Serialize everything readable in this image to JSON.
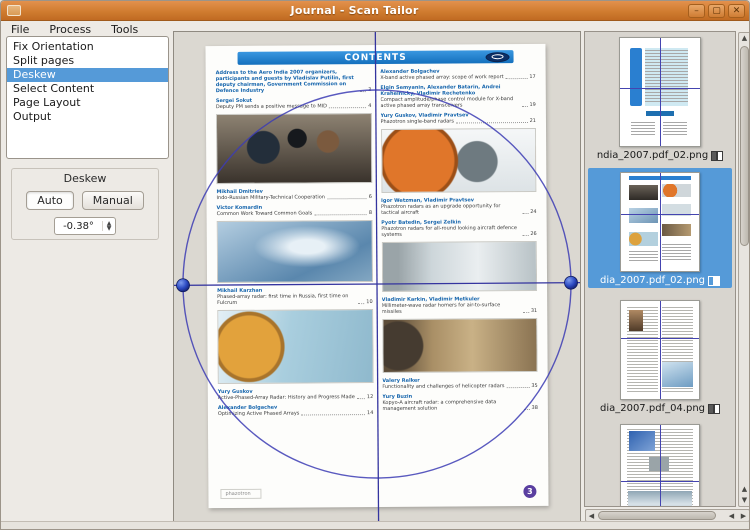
{
  "window": {
    "title": "Journal - Scan Tailor",
    "menu": [
      "File",
      "Process",
      "Tools"
    ]
  },
  "icons": {
    "minimize": "–",
    "maximize": "▢",
    "close": "✕",
    "spin_up": "▲",
    "spin_down": "▼",
    "scroll_up": "▲",
    "scroll_down": "▼",
    "scroll_left": "◀",
    "scroll_right": "▶"
  },
  "stages": {
    "items": [
      "Fix Orientation",
      "Split pages",
      "Deskew",
      "Select Content",
      "Page Layout",
      "Output"
    ],
    "selected": "Deskew"
  },
  "deskew_panel": {
    "title": "Deskew",
    "auto_label": "Auto",
    "manual_label": "Manual",
    "angle_value": "-0.38°"
  },
  "page": {
    "header": "CONTENTS",
    "footer_text": "phazotron",
    "page_number": "3",
    "left_column": [
      {
        "lead": true,
        "title": "Address to the Aero India 2007 organizers, participants and guests by Vladislav Putilin, first deputy chairman, Government Commission on Defence Industry",
        "page": "3"
      },
      {
        "author": "Sergei Sokut",
        "title": "Deputy PM sends a positive message to MID",
        "page": "4"
      },
      {
        "photo": "group",
        "alt": "officials-group-photo"
      },
      {
        "author": "Mikhail Dmitriev",
        "title": "Indo-Russian Military-Technical Cooperation",
        "page": "6"
      },
      {
        "author": "Victor Komardin",
        "title": "Common Work Toward Common Goals",
        "page": "8"
      },
      {
        "photo": "jet",
        "alt": "fighter-aircraft-photo"
      },
      {
        "author": "Mikhail Karzhan",
        "title": "Phased-array radar: first time in Russia, first time on Fulcrum",
        "page": "10"
      },
      {
        "photo": "radar-cyan",
        "alt": "radar-unit-photo"
      },
      {
        "author": "Yury Guskov",
        "title": "Active-Phased-Array Radar: History and Progress Made",
        "page": "12"
      },
      {
        "author": "Alexander Bolgachev",
        "title": "Optimizing Active Phased Arrays",
        "page": "14"
      }
    ],
    "right_column": [
      {
        "author": "Alexander Bolgachev",
        "title": "X-band active phased array: scope of work report",
        "page": "17"
      },
      {
        "author": "Elgin Semyanin, Alexander Batarin, Andrei Krahelnicky, Vladimir Rechetenko",
        "title": "Compact amplitude/phase control module for X-band active phased array transceivers",
        "page": "19"
      },
      {
        "author": "Yury Guskov, Vladimir Pravtsev",
        "title": "Phazotron single-band radars",
        "page": "21"
      },
      {
        "photo": "radar-orange",
        "alt": "phased-array-radar-photo"
      },
      {
        "author": "Igor Wetzman, Vladimir Pravtsev",
        "title": "Phazotron radars as an upgrade opportunity for tactical aircraft",
        "page": "24"
      },
      {
        "author": "Pyotr Batedin, Sergei Zelkin",
        "title": "Phazotron radars for all-round looking aircraft defence systems",
        "page": "26"
      },
      {
        "photo": "equipment",
        "alt": "radar-equipment-photo"
      },
      {
        "author": "Vladimir Karkin, Vladimir Metkuler",
        "title": "Millimeter-wave radar homers for air-to-surface missiles",
        "page": "31"
      },
      {
        "photo": "seeker",
        "alt": "radar-seeker-photo"
      },
      {
        "author": "Valery Relker",
        "title": "Functionality and challenges of helicopter radars",
        "page": "35"
      },
      {
        "author": "Yury Buzin",
        "title": "Kopyo-A aircraft radar: a comprehensive data management solution",
        "page": "38"
      }
    ]
  },
  "thumbnails": [
    {
      "caption": "ndia_2007.pdf_02.png",
      "side": "left",
      "selected": false
    },
    {
      "caption": "dia_2007.pdf_02.png",
      "side": "right",
      "selected": true
    },
    {
      "caption": "dia_2007.pdf_04.png",
      "side": "left",
      "selected": false
    },
    {
      "caption": "",
      "side": "",
      "selected": false
    }
  ],
  "colors": {
    "titlebar_orange": "#d07c30",
    "selection_blue": "#559ad8",
    "overlay_indigo": "#3c3cb4",
    "contents_bar_blue": "#1470bd",
    "page_number_purple": "#5a3fa0"
  }
}
